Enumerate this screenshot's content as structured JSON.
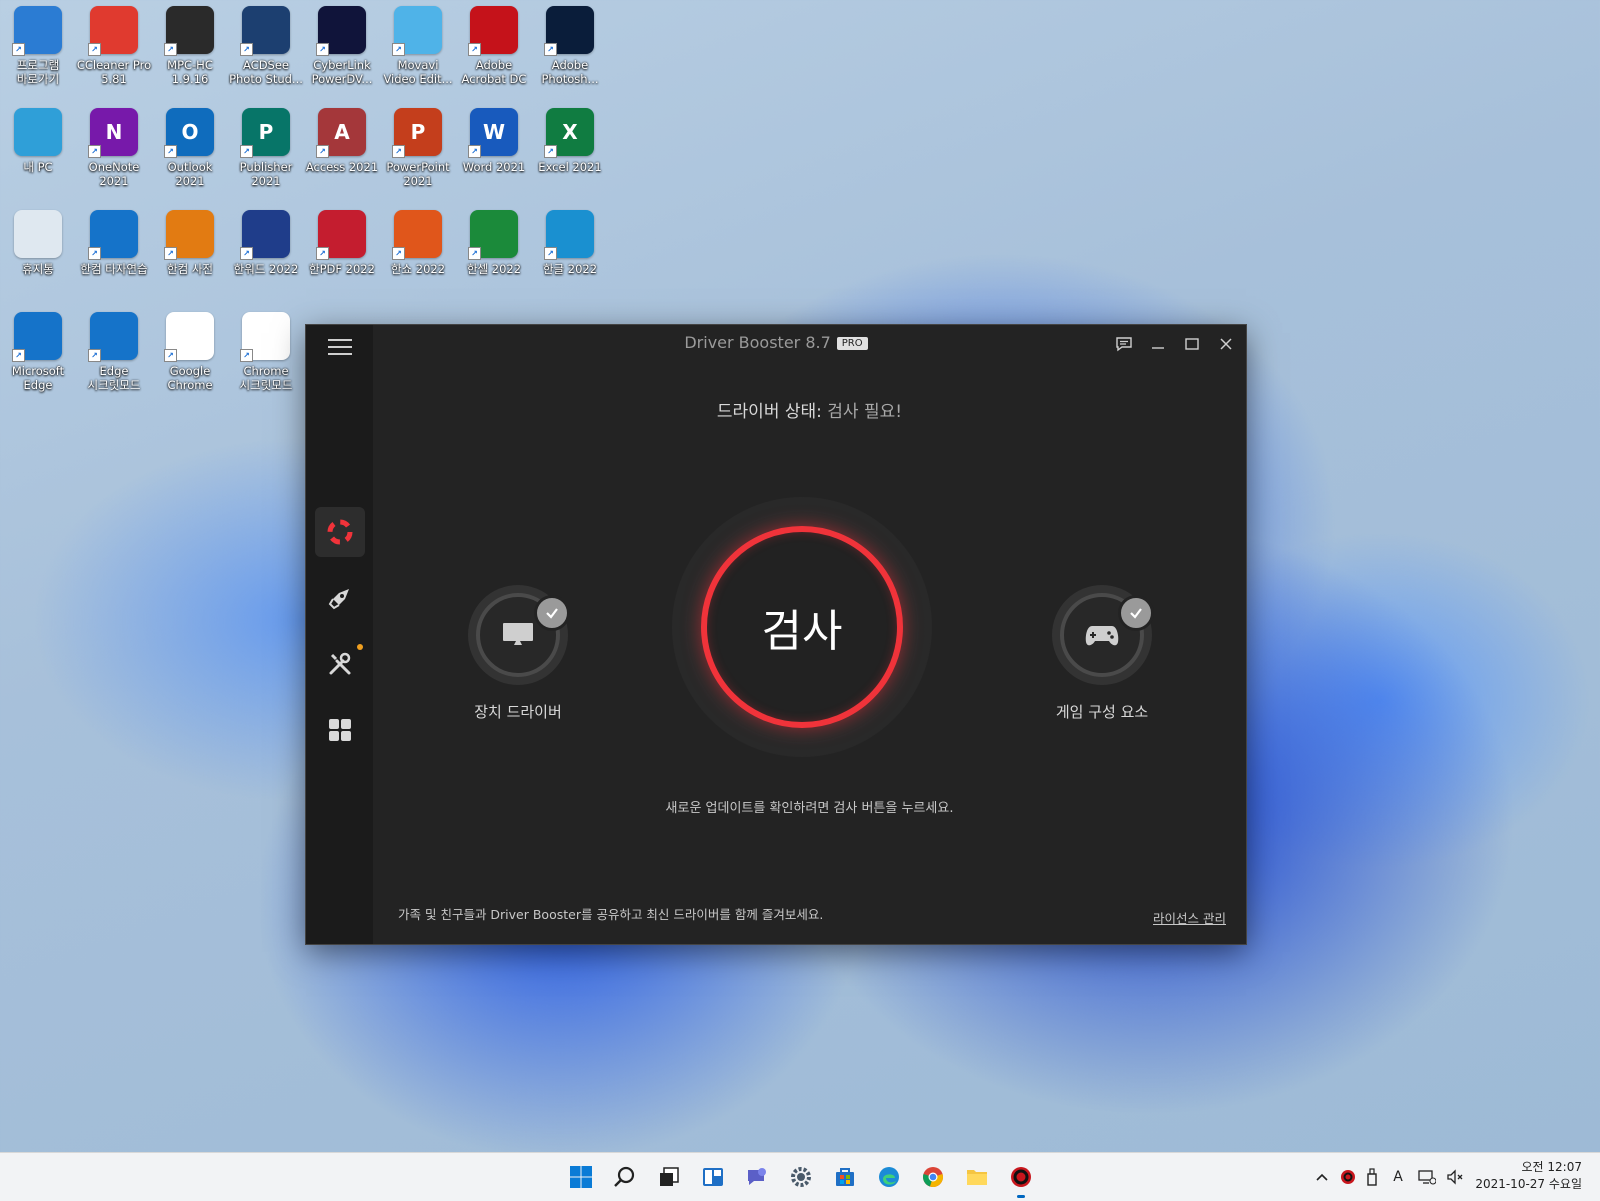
{
  "desktop": {
    "icons": [
      {
        "label": "프로그램 바로가기",
        "icon": "tv-icon",
        "color": "#2b7cd3"
      },
      {
        "label": "CCleaner Pro 5.81",
        "icon": "ccleaner-icon",
        "color": "#e03a2f"
      },
      {
        "label": "MPC-HC 1.9.16",
        "icon": "mpc-hc-icon",
        "color": "#2a2a2a"
      },
      {
        "label": "ACDSee Photo Stud...",
        "icon": "acdsee-icon",
        "color": "#1c3f70"
      },
      {
        "label": "CyberLink PowerDV...",
        "icon": "powerdvd-icon",
        "color": "#10143a"
      },
      {
        "label": "Movavi Video Edit...",
        "icon": "movavi-icon",
        "color": "#4fb3e8"
      },
      {
        "label": "Adobe Acrobat DC",
        "icon": "acrobat-icon",
        "color": "#c5121a"
      },
      {
        "label": "Adobe Photosh...",
        "icon": "photoshop-icon",
        "color": "#0a1d3a"
      },
      {
        "label": "내 PC",
        "icon": "monitor-icon",
        "color": "#2f9fd8"
      },
      {
        "label": "OneNote 2021",
        "icon": "onenote-icon",
        "color": "#7719aa",
        "glyph": "N"
      },
      {
        "label": "Outlook 2021",
        "icon": "outlook-icon",
        "color": "#0f6cbd",
        "glyph": "O"
      },
      {
        "label": "Publisher 2021",
        "icon": "publisher-icon",
        "color": "#077568",
        "glyph": "P"
      },
      {
        "label": "Access 2021",
        "icon": "access-icon",
        "color": "#a4373a",
        "glyph": "A"
      },
      {
        "label": "PowerPoint 2021",
        "icon": "powerpoint-icon",
        "color": "#c43e1c",
        "glyph": "P"
      },
      {
        "label": "Word 2021",
        "icon": "word-icon",
        "color": "#185abd",
        "glyph": "W"
      },
      {
        "label": "Excel 2021",
        "icon": "excel-icon",
        "color": "#107c41",
        "glyph": "X"
      },
      {
        "label": "휴지통",
        "icon": "recycle-bin-icon",
        "color": "#dfe8f0"
      },
      {
        "label": "한컴 타자연습",
        "icon": "edge-icon",
        "color": "#1573c9"
      },
      {
        "label": "한컴 사전",
        "icon": "hancom-dictionary-icon",
        "color": "#e27b12"
      },
      {
        "label": "한워드 2022",
        "icon": "hanword-icon",
        "color": "#1f3d8a"
      },
      {
        "label": "한PDF 2022",
        "icon": "hanpdf-icon",
        "color": "#c41d2f"
      },
      {
        "label": "한쇼 2022",
        "icon": "hanshow-icon",
        "color": "#e0561b"
      },
      {
        "label": "한셀 2022",
        "icon": "hancell-icon",
        "color": "#1b8a3a"
      },
      {
        "label": "한글 2022",
        "icon": "hangul-icon",
        "color": "#1a90d0"
      },
      {
        "label": "Microsoft Edge",
        "icon": "edge-icon",
        "color": "#1573c9"
      },
      {
        "label": "Edge 시크릿모드",
        "icon": "edge-icon",
        "color": "#1573c9"
      },
      {
        "label": "Google Chrome",
        "icon": "chrome-icon",
        "color": "#ffffff"
      },
      {
        "label": "Chrome 시크릿모드",
        "icon": "chrome-icon",
        "color": "#ffffff"
      }
    ]
  },
  "app": {
    "title": "Driver Booster 8.7",
    "badge": "PRO",
    "status_label": "드라이버 상태:",
    "status_value": "검사 필요!",
    "scan_label": "검사",
    "device_driver_label": "장치 드라이버",
    "game_components_label": "게임 구성 요소",
    "hint": "새로운 업데이트를 확인하려면 검사 버튼을 누르세요.",
    "share_text": "가족 및 친구들과 Driver Booster를 공유하고 최신 드라이버를 함께 즐겨보세요.",
    "license_link": "라이선스 관리",
    "accent_color": "#f0333a"
  },
  "taskbar": {
    "clock_time": "오전 12:07",
    "clock_date": "2021-10-27 수요일",
    "ime_indicator": "A"
  }
}
